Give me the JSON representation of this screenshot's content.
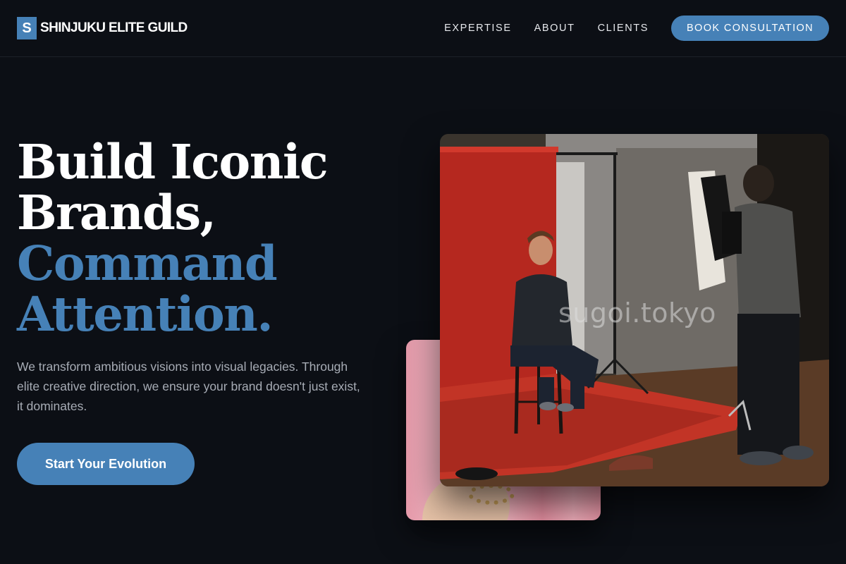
{
  "brand": {
    "mark": "S",
    "name": "SHINJUKU ELITE GUILD",
    "accent_color": "#4681b7",
    "background_color": "#0c0f15"
  },
  "nav": {
    "items": [
      {
        "label": "EXPERTISE"
      },
      {
        "label": "ABOUT"
      },
      {
        "label": "CLIENTS"
      }
    ],
    "cta_label": "BOOK CONSULTATION"
  },
  "hero": {
    "title_lines": [
      {
        "text": "Build Iconic",
        "color": "white"
      },
      {
        "text": "Brands,",
        "color": "white"
      },
      {
        "text": "Command",
        "color": "accent"
      },
      {
        "text": "Attention.",
        "color": "accent"
      }
    ],
    "description": "We transform ambitious visions into visual legacies. Through elite creative direction, we ensure your brand doesn't just exist, it dominates.",
    "cta_label": "Start Your Evolution"
  },
  "images": {
    "main_watermark": "sugoi.tokyo"
  }
}
